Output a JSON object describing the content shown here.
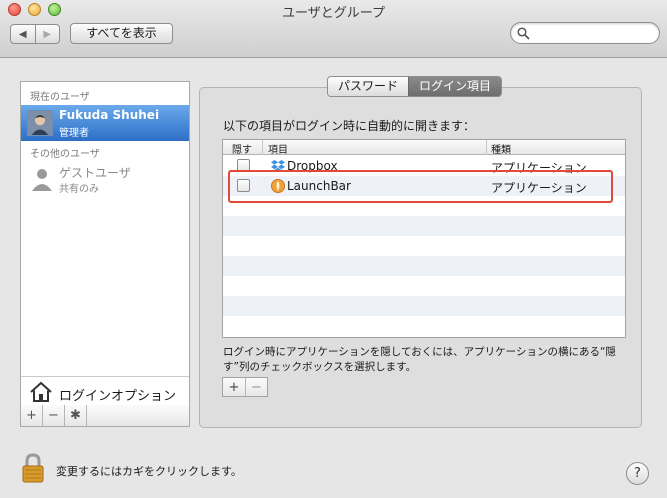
{
  "window": {
    "title": "ユーザとグループ"
  },
  "toolbar": {
    "back_glyph": "◀",
    "forward_glyph": "▶",
    "show_all_label": "すべてを表示",
    "search_placeholder": ""
  },
  "sidebar": {
    "current_header": "現在のユーザ",
    "current_user": {
      "name": "Fukuda Shuhei",
      "role": "管理者"
    },
    "other_header": "その他のユーザ",
    "guest_user": {
      "name": "ゲストユーザ",
      "role": "共有のみ"
    },
    "login_options_label": "ログインオプション",
    "add_glyph": "+",
    "remove_glyph": "−",
    "action_glyph": "✱"
  },
  "tabs": [
    {
      "label": "パスワード",
      "active": false
    },
    {
      "label": "ログイン項目",
      "active": true
    }
  ],
  "main": {
    "intro": "以下の項目がログイン時に自動的に開きます：",
    "columns": {
      "hide": "隠す",
      "item": "項目",
      "kind": "種類"
    },
    "rows": [
      {
        "name": "Dropbox",
        "kind": "アプリケーション",
        "hidden": false,
        "icon": "dropbox-icon"
      },
      {
        "name": "LaunchBar",
        "kind": "アプリケーション",
        "hidden": false,
        "icon": "launchbar-icon"
      }
    ],
    "hint": "ログイン時にアプリケーションを隠しておくには、アプリケーションの横にある“隠す”列のチェックボックスを選択します。",
    "add_glyph": "+",
    "remove_glyph": "−"
  },
  "footer": {
    "lock_text": "変更するにはカギをクリックします。",
    "help_glyph": "?"
  },
  "colors": {
    "selection": "#2d6fc8",
    "highlight": "#e2493a",
    "row_alt": "#eef2f8"
  }
}
